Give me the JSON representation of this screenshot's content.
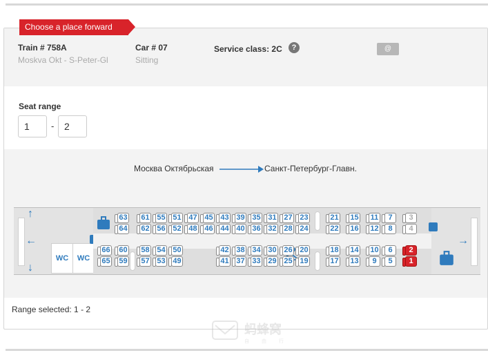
{
  "ribbon": "Choose a place forward",
  "train": {
    "label": "Train # 758A",
    "route": "Moskva Okt - S-Peter-Gl"
  },
  "car": {
    "label": "Car # 07",
    "type": "Sitting"
  },
  "service": {
    "label": "Service class: 2C",
    "help": "?"
  },
  "ticket_icon": "@",
  "seat_range": {
    "title": "Seat range",
    "from": "1",
    "separator": "-",
    "to": "2"
  },
  "direction": {
    "from": "Москва Октябрьская",
    "to": "Санкт-Петербург-Главн."
  },
  "car_map": {
    "wc_label": "WC",
    "row1": [
      "63",
      "61",
      "55",
      "51",
      "47",
      "45",
      "43",
      "39",
      "35",
      "31",
      "27",
      "23",
      "21",
      "15",
      "11",
      "7",
      "3"
    ],
    "row2": [
      "64",
      "62",
      "56",
      "52",
      "48",
      "46",
      "44",
      "40",
      "36",
      "32",
      "28",
      "24",
      "22",
      "16",
      "12",
      "8",
      "4"
    ],
    "row3": [
      "66",
      "60",
      "58",
      "54",
      "50",
      "42",
      "38",
      "34",
      "30",
      "26",
      "20",
      "18",
      "14",
      "10",
      "6",
      "2"
    ],
    "row4": [
      "65",
      "59",
      "57",
      "53",
      "49",
      "41",
      "37",
      "33",
      "29",
      "25",
      "19",
      "17",
      "13",
      "9",
      "5",
      "1"
    ],
    "selected": [
      "1",
      "2"
    ],
    "unavailable": [
      "3",
      "4"
    ]
  },
  "status": "Range selected: 1 - 2",
  "watermark": {
    "text": "蚂蜂窝",
    "sub": "自 由 行"
  },
  "colors": {
    "accent": "#d8232a",
    "seat_text": "#2f7bbd"
  }
}
